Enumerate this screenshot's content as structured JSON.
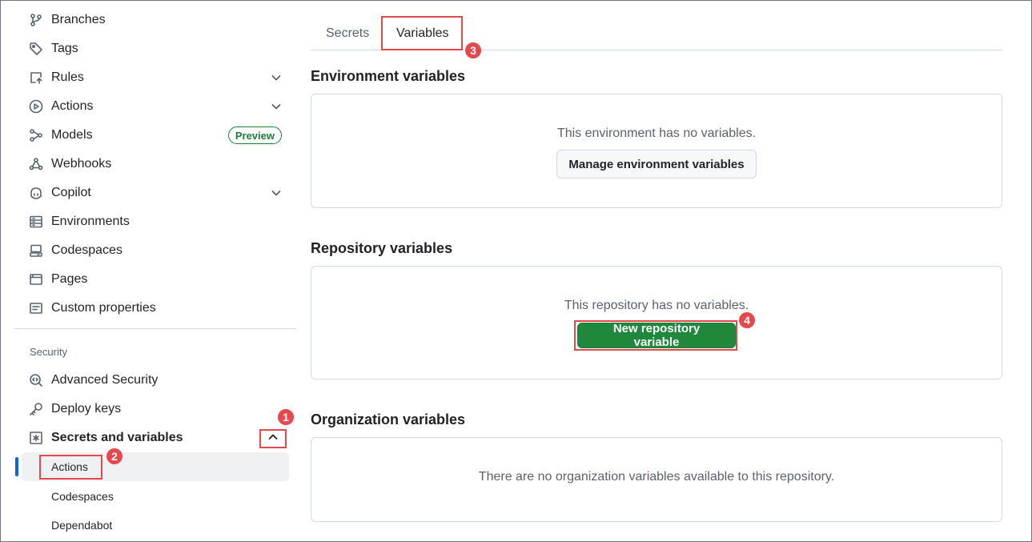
{
  "sidebar": {
    "items": [
      {
        "label": "Branches",
        "icon": "git-branch-icon"
      },
      {
        "label": "Tags",
        "icon": "tag-icon"
      },
      {
        "label": "Rules",
        "icon": "rules-icon"
      },
      {
        "label": "Actions",
        "icon": "play-icon"
      },
      {
        "label": "Models",
        "icon": "models-icon",
        "badge": "Preview"
      },
      {
        "label": "Webhooks",
        "icon": "webhook-icon"
      },
      {
        "label": "Copilot",
        "icon": "copilot-icon"
      },
      {
        "label": "Environments",
        "icon": "server-icon"
      },
      {
        "label": "Codespaces",
        "icon": "codespaces-icon"
      },
      {
        "label": "Pages",
        "icon": "browser-icon"
      },
      {
        "label": "Custom properties",
        "icon": "note-icon"
      }
    ],
    "security_label": "Security",
    "security_items": [
      {
        "label": "Advanced Security",
        "icon": "codescan-icon"
      },
      {
        "label": "Deploy keys",
        "icon": "key-icon"
      },
      {
        "label": "Secrets and variables",
        "icon": "asterisk-icon"
      }
    ],
    "sub_items": [
      {
        "label": "Actions"
      },
      {
        "label": "Codespaces"
      },
      {
        "label": "Dependabot"
      }
    ]
  },
  "tabs": [
    {
      "label": "Secrets"
    },
    {
      "label": "Variables"
    }
  ],
  "sections": {
    "environment": {
      "title": "Environment variables",
      "message": "This environment has no variables.",
      "button": "Manage environment variables"
    },
    "repository": {
      "title": "Repository variables",
      "message": "This repository has no variables.",
      "button": "New repository variable"
    },
    "organization": {
      "title": "Organization variables",
      "message": "There are no organization variables available to this repository."
    }
  },
  "callouts": [
    "1",
    "2",
    "3",
    "4"
  ],
  "colors": {
    "annotation": "#e5484d",
    "primary_button": "#1f883d",
    "active_indicator": "#0969da",
    "preview_badge": "#1a7f37"
  }
}
